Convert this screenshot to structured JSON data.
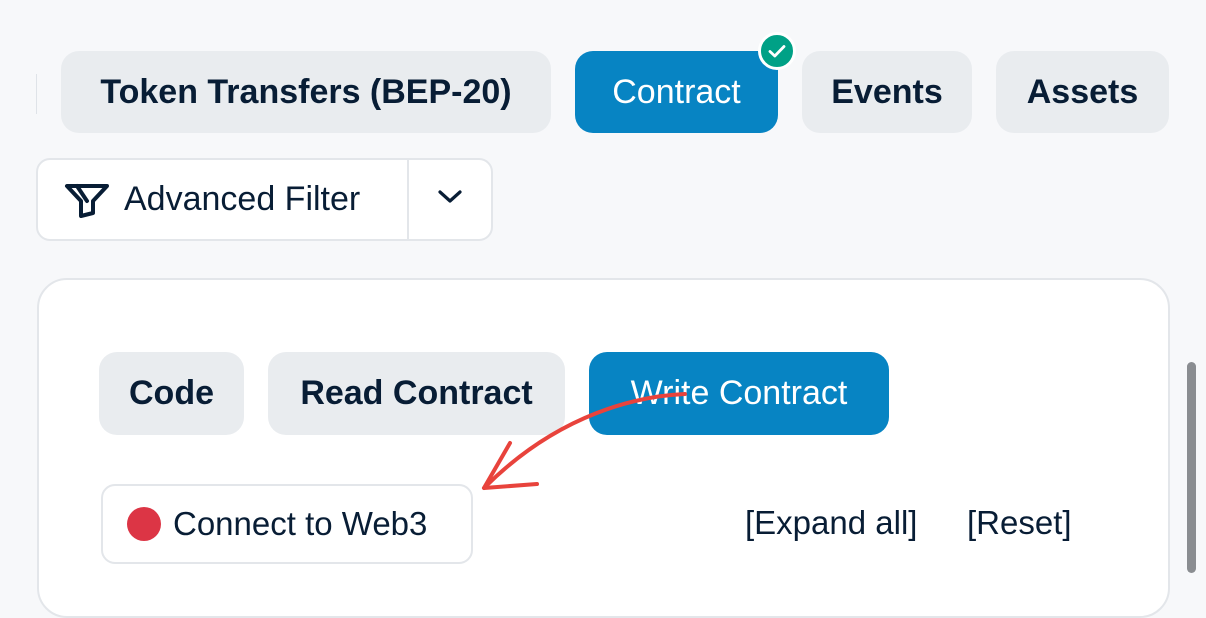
{
  "tabs": [
    {
      "label": "Token Transfers (BEP-20)",
      "active": false
    },
    {
      "label": "Contract",
      "active": true,
      "verified": true
    },
    {
      "label": "Events",
      "active": false
    },
    {
      "label": "Assets",
      "active": false
    }
  ],
  "filter": {
    "label": "Advanced Filter",
    "icon": "filter-icon",
    "toggle_icon": "chevron-down-icon"
  },
  "contract_tabs": [
    {
      "label": "Code",
      "active": false
    },
    {
      "label": "Read Contract",
      "active": false
    },
    {
      "label": "Write Contract",
      "active": true
    }
  ],
  "connect": {
    "label": "Connect to Web3",
    "status_color": "#dc3545"
  },
  "links": {
    "expand_all": "[Expand all]",
    "reset": "[Reset]"
  },
  "colors": {
    "accent": "#0784c3",
    "verified": "#00a186",
    "annotation_arrow": "#e8433c"
  }
}
